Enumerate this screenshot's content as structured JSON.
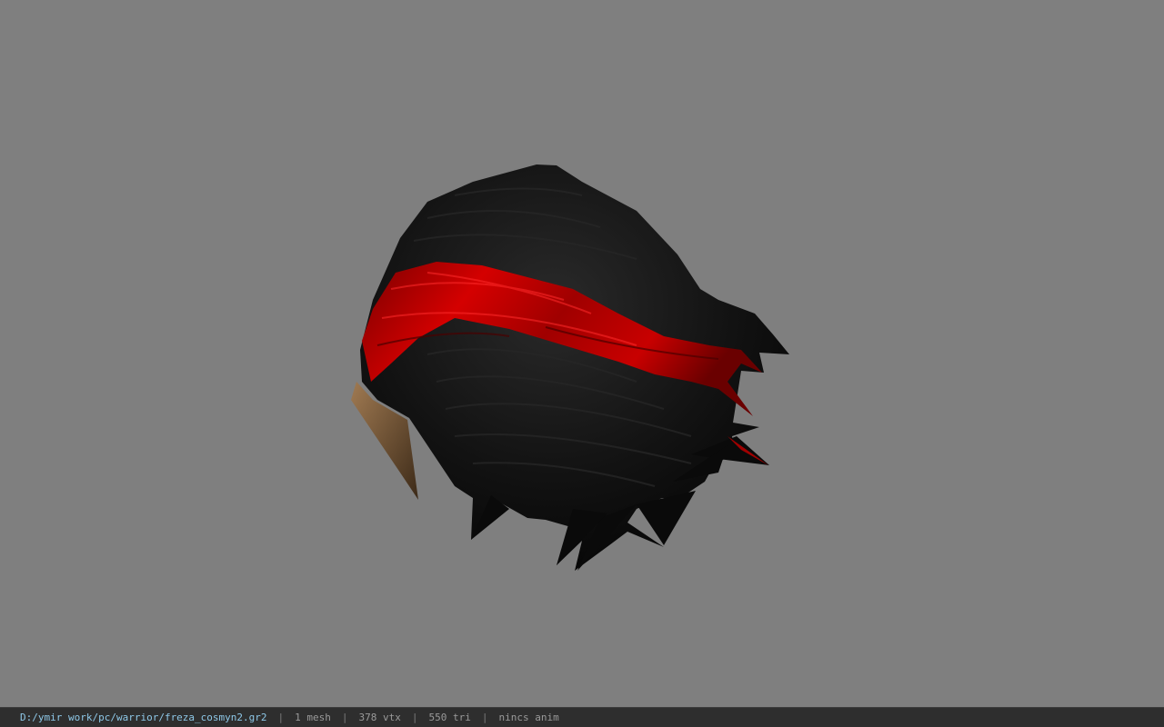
{
  "viewport": {
    "background": "#7f7f7f",
    "model_name": "hair-mesh-icon"
  },
  "status_bar": {
    "file_path": "D:/ymir work/pc/warrior/freza_cosmyn2.gr2",
    "separator": "|",
    "mesh_count": "1 mesh",
    "vertex_count": "378 vtx",
    "triangle_count": "550 tri",
    "anim_status": "nincs anim"
  },
  "colors": {
    "hair": "#0c0c0c",
    "bandana": "#b00000",
    "skin": "#8a6a48",
    "status_path": "#8ec8e8"
  }
}
